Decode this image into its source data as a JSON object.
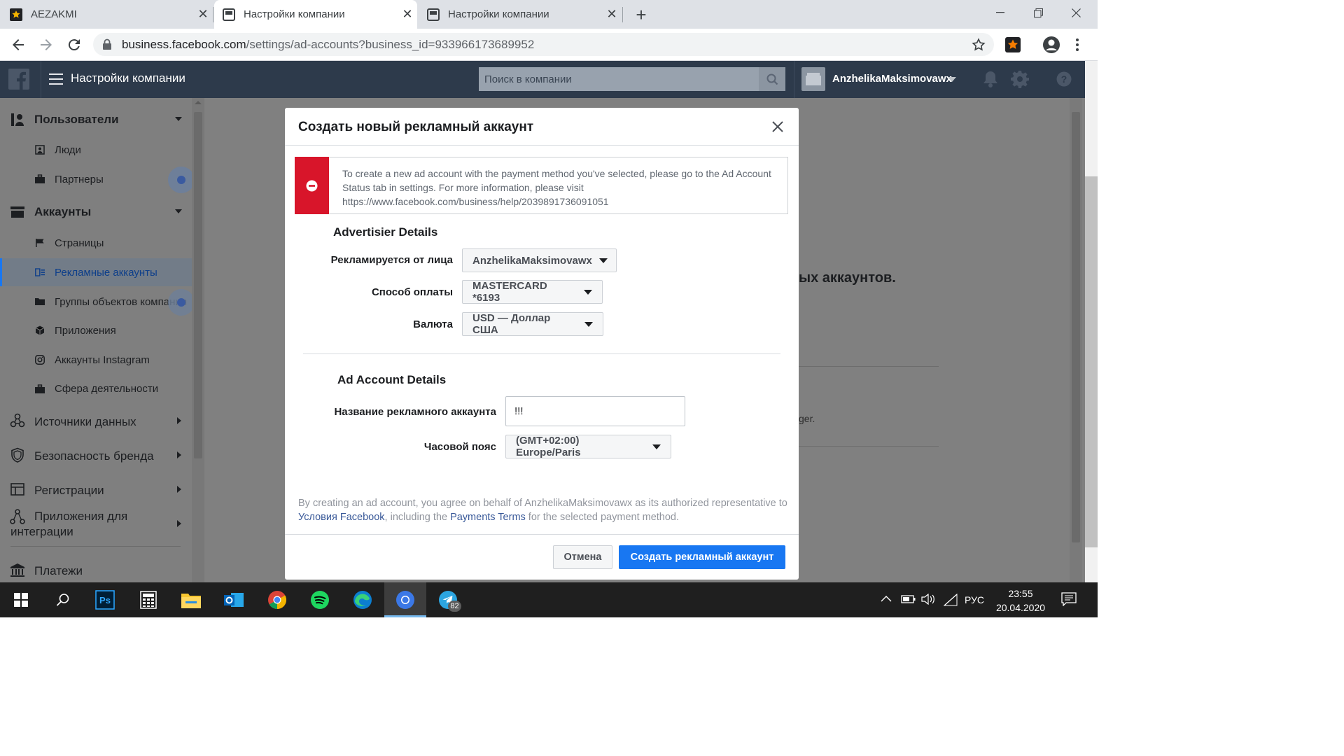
{
  "browser": {
    "tabs": [
      {
        "title": "AEZAKMI",
        "active": false
      },
      {
        "title": "Настройки компании",
        "active": true
      },
      {
        "title": "Настройки компании",
        "active": false
      }
    ],
    "url_host": "business.facebook.com",
    "url_path": "/settings/ad-accounts?business_id=933966173689952"
  },
  "fb_header": {
    "title": "Настройки компании",
    "search_placeholder": "Поиск в компании",
    "account_name": "AnzhelikaMaksimovawx"
  },
  "sidebar": {
    "users_label": "Пользователи",
    "people_label": "Люди",
    "partners_label": "Партнеры",
    "accounts_label": "Аккаунты",
    "pages_label": "Страницы",
    "ad_accounts_label": "Рекламные аккаунты",
    "asset_groups_label": "Группы объектов компании",
    "apps_label": "Приложения",
    "instagram_label": "Аккаунты Instagram",
    "lines_of_business_label": "Сфера деятельности",
    "data_sources_label": "Источники данных",
    "brand_safety_label": "Безопасность бренда",
    "registrations_label": "Регистрации",
    "integrations_label_1": "Приложения для",
    "integrations_label_2": "интеграции",
    "payments_label": "Платежи"
  },
  "background_page": {
    "heading_fragment": "ых аккаунтов.",
    "text_fragment": "ger."
  },
  "dialog": {
    "title": "Создать новый рекламный аккаунт",
    "error_text": "To create a new ad account with the payment method you've selected, please go to the Ad Account Status tab in settings. For more information, please visit https://www.facebook.com/business/help/2039891736091051",
    "advertiser_heading": "Advertisier Details",
    "advertiser_label": "Рекламируется от лица",
    "advertiser_value": "AnzhelikaMaksimovawx",
    "payment_label": "Способ оплаты",
    "payment_value": "MASTERCARD *6193",
    "currency_label": "Валюта",
    "currency_value": "USD — Доллар США",
    "ad_account_heading": "Ad Account Details",
    "account_name_label": "Название рекламного аккаунта",
    "account_name_value": "!!!",
    "timezone_label": "Часовой пояс",
    "timezone_value": "(GMT+02:00) Europe/Paris",
    "legal_part1": "By creating an ad account, you agree on behalf of AnzhelikaMaksimovawx as its authorized representative to ",
    "legal_link1": "Условия Facebook",
    "legal_part2": ", including the ",
    "legal_link2": "Payments Terms",
    "legal_part3": " for the selected payment method.",
    "cancel_label": "Отмена",
    "create_label": "Создать рекламный аккаунт"
  },
  "taskbar": {
    "telegram_badge": "82",
    "language": "РУС",
    "time": "23:55",
    "date": "20.04.2020"
  },
  "colors": {
    "fb_bar": "#2d3a4b",
    "primary_blue": "#1877f2",
    "error_red": "#d8152a",
    "link": "#385898"
  }
}
